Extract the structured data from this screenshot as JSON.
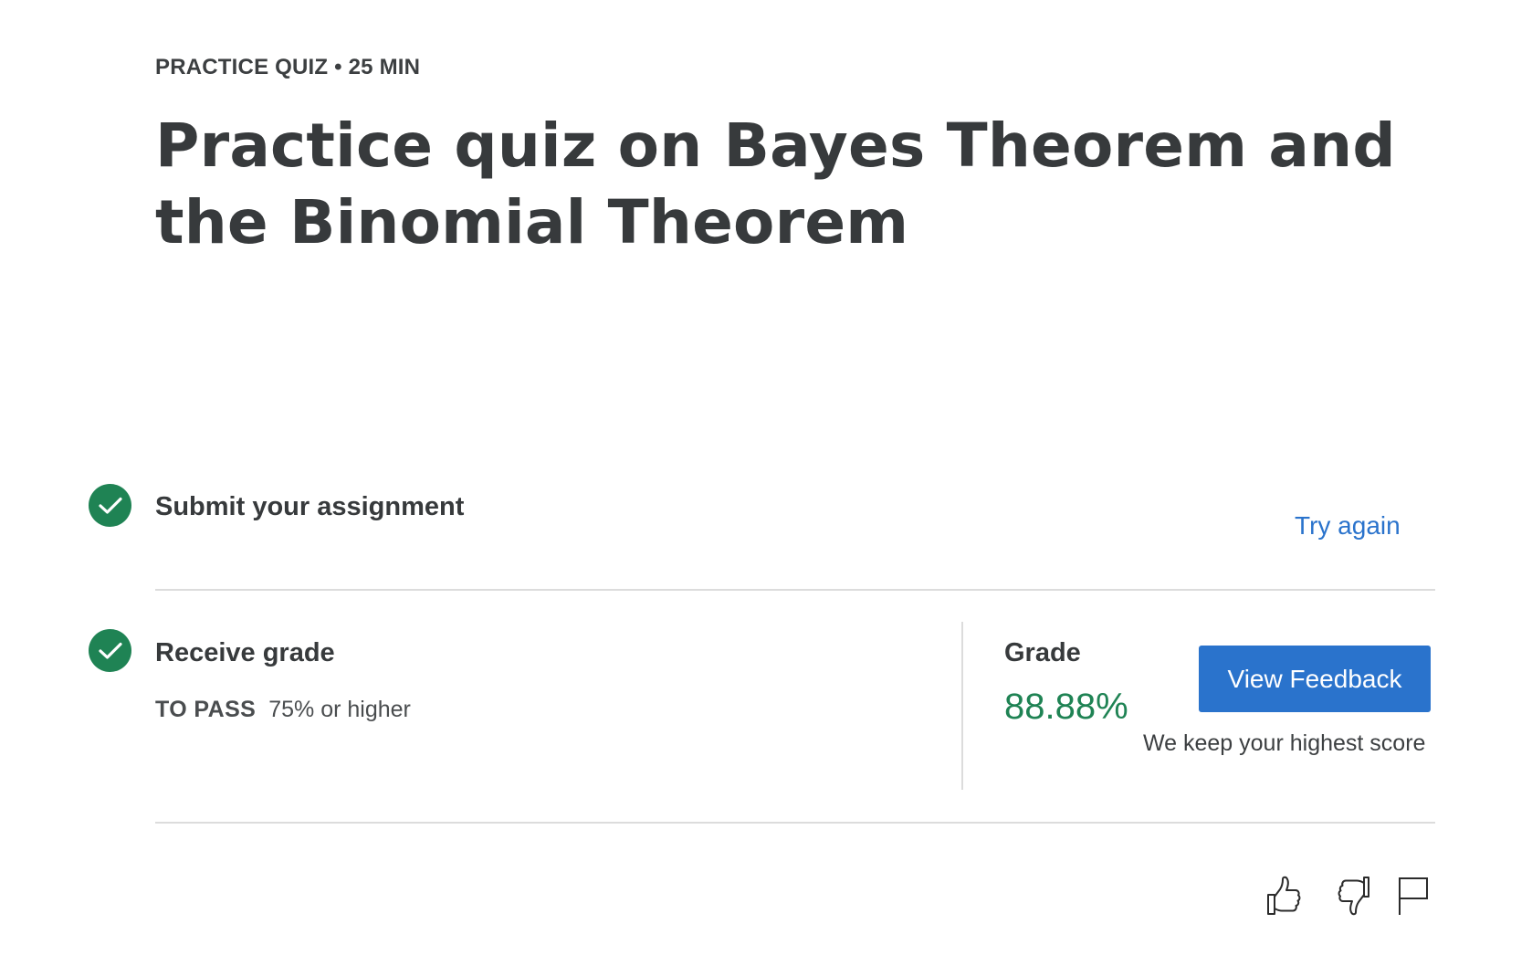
{
  "header": {
    "eyebrow": "PRACTICE QUIZ • 25 MIN",
    "title": "Practice quiz on Bayes Theorem and the Binomial Theorem"
  },
  "steps": {
    "submit": {
      "label": "Submit your assignment",
      "action": "Try again",
      "icon": "check-circle-icon",
      "status": "complete"
    },
    "grade": {
      "label": "Receive grade",
      "pass_label": "TO PASS",
      "pass_value": "75% or higher",
      "icon": "check-circle-icon",
      "status": "complete"
    }
  },
  "grade_panel": {
    "label": "Grade",
    "value": "88.88%",
    "button": "View Feedback",
    "note": "We keep your highest score"
  },
  "feedback_icons": [
    "thumbs-up-icon",
    "thumbs-down-icon",
    "flag-icon"
  ],
  "colors": {
    "success": "#1f8354",
    "link": "#2a73cc",
    "primary_button": "#2a73cc",
    "text": "#373a3c",
    "divider": "#dcdcdc"
  }
}
